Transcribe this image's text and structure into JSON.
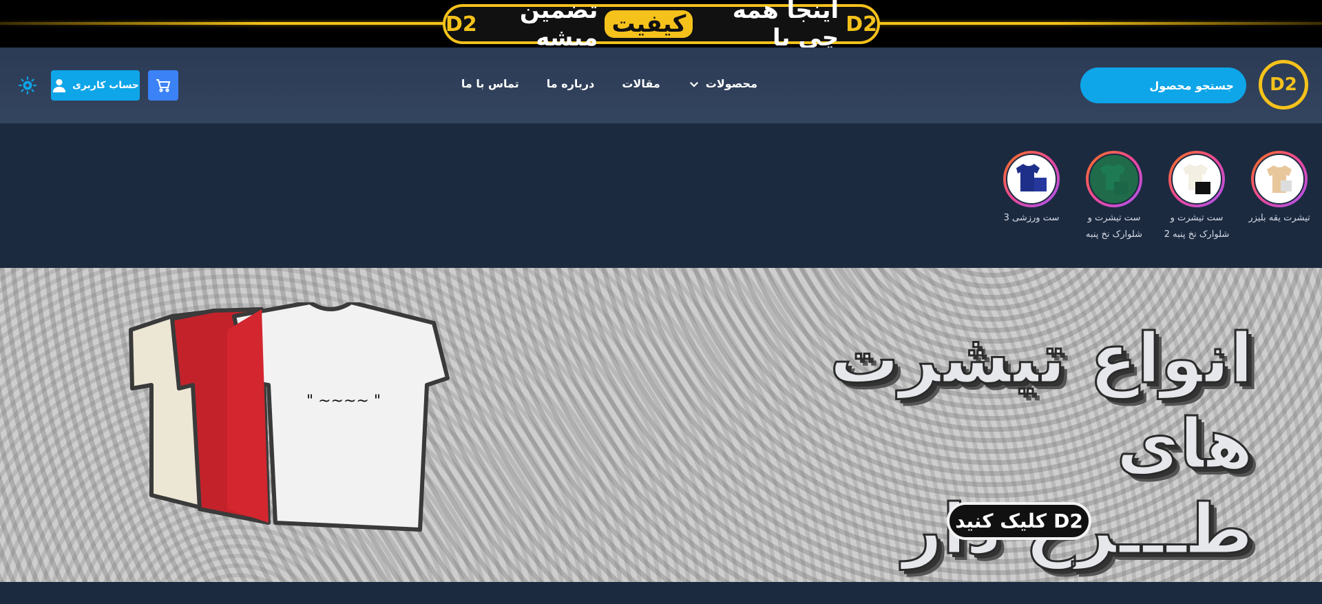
{
  "promo": {
    "prefix": "اینجا همه چی با",
    "highlight": "کیفیت",
    "suffix": "تضمین میشه",
    "logo": "D2",
    "accent": "#f5c21b"
  },
  "header": {
    "logo": "D2",
    "search_placeholder": "جستجو محصول",
    "nav": [
      {
        "label": "محصولات"
      },
      {
        "label": "مقالات"
      },
      {
        "label": "درباره ما"
      },
      {
        "label": "تماس با ما"
      }
    ],
    "account_label": "حساب کاربری",
    "colors": {
      "search": "#0ea5e9",
      "cart": "#3b82f6",
      "account": "#0ea5e9"
    }
  },
  "stories": [
    {
      "line1": "تیشرت یقه بلیزر",
      "line2": ""
    },
    {
      "line1": "ست تیشرت و",
      "line2": "شلوارک نخ پنبه 2"
    },
    {
      "line1": "ست تیشرت و",
      "line2": "شلوارک نخ پنبه"
    },
    {
      "line1": "ست ورزشی 3",
      "line2": ""
    }
  ],
  "hero": {
    "title_line1": "انواع تیشرت های",
    "title_line2": "طـــرح دار",
    "button_label": "کلیک کنید",
    "button_logo": "D2"
  }
}
